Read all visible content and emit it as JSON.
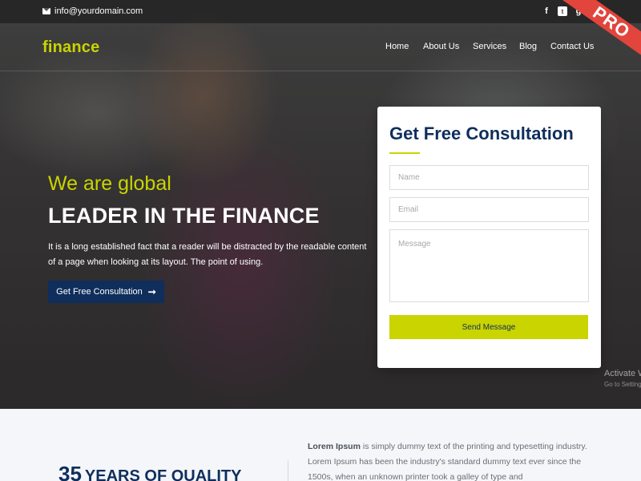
{
  "topbar": {
    "email": "info@yourdomain.com"
  },
  "social": {
    "fb": "f",
    "tw": "t",
    "gp": "g"
  },
  "ribbon": "PRO",
  "logo": "finance",
  "nav": [
    "Home",
    "About Us",
    "Services",
    "Blog",
    "Contact Us"
  ],
  "hero": {
    "subtitle": "We are global",
    "title": "LEADER IN THE FINANCE",
    "text": "It is a long established fact that a reader will be distracted by the readable content of a page when looking at its layout. The point of using.",
    "cta": "Get Free Consultation"
  },
  "form": {
    "title": "Get Free Consultation",
    "name_placeholder": "Name",
    "email_placeholder": "Email",
    "message_placeholder": "Message",
    "submit": "Send Message"
  },
  "watermark": {
    "title": "Activate W",
    "sub": "Go to Setting"
  },
  "about": {
    "years_number": "35",
    "years_text": "YEARS OF QUALITY",
    "lead": "Lorem Ipsum",
    "body": " is simply dummy text of the printing and typesetting industry. Lorem Ipsum has been the industry's standard dummy text ever since the 1500s, when an unknown printer took a galley of type and"
  },
  "colors": {
    "accent": "#c9d400",
    "navy": "#0f2e5c",
    "ribbon": "#e2453c"
  }
}
